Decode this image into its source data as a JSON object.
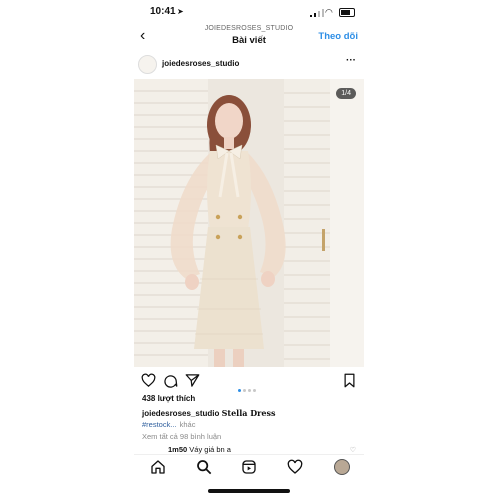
{
  "status_bar": {
    "time": "10:41",
    "location_icon": "location-arrow-icon",
    "signal_icon": "signal-icon",
    "wifi_icon": "wifi-icon",
    "battery_icon": "battery-icon"
  },
  "header": {
    "account": "JOIEDESROSES_STUDIO",
    "title": "Bài viết",
    "follow_label": "Theo dõi",
    "back_icon": "chevron-left-icon"
  },
  "post": {
    "username": "joiedesroses_studio",
    "more_icon": "ellipsis-icon",
    "image_counter": "1/4",
    "carousel": {
      "count": 4,
      "active_index": 0
    },
    "likes": "438 lượt thích",
    "caption_user": "joiedesroses_studio",
    "caption_text": "Stella Dress",
    "hashtag": "#restock...",
    "more": "khác",
    "view_comments": "Xem tất cả 98 bình luận",
    "comment_user": "1m50",
    "comment_text": "Váy giá bn a"
  },
  "actions": {
    "like_icon": "heart-icon",
    "comment_icon": "comment-icon",
    "share_icon": "send-icon",
    "save_icon": "bookmark-icon"
  },
  "tabbar": {
    "items": [
      "home-icon",
      "search-icon",
      "reels-icon",
      "heart-icon",
      "profile-avatar"
    ]
  },
  "colors": {
    "link_blue": "#2d8ee6",
    "hashtag_blue": "#2f5f9e",
    "muted": "#8a8a8a"
  }
}
